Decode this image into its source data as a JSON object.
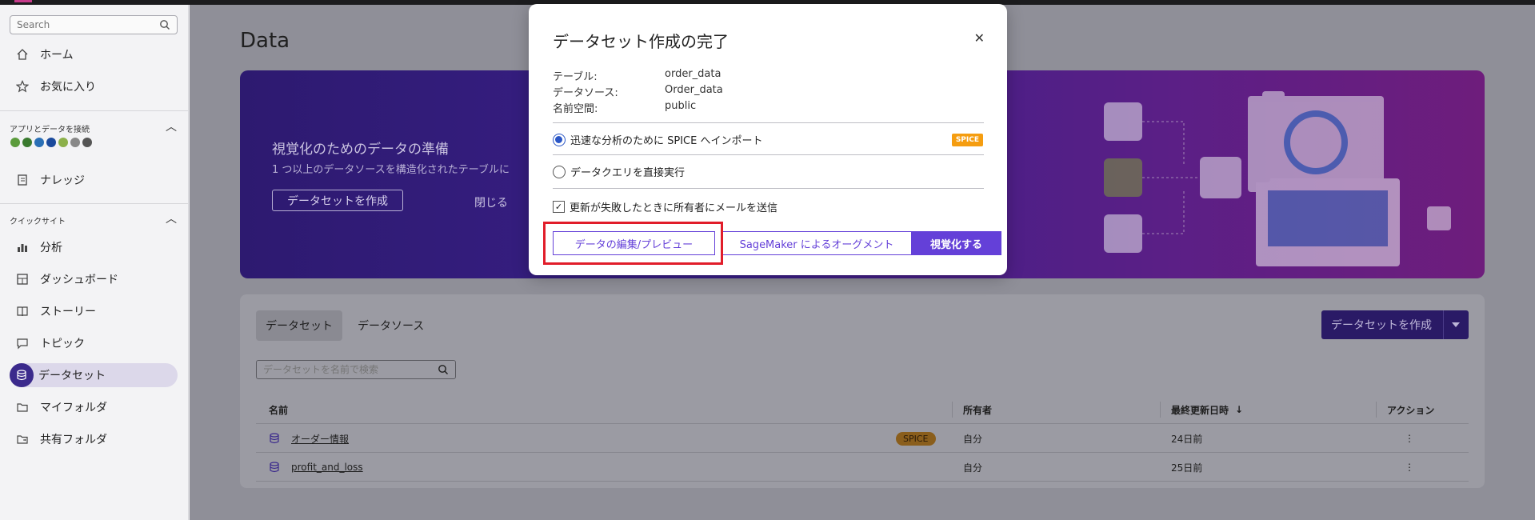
{
  "sidebar": {
    "search_placeholder": "Search",
    "items_top": [
      {
        "label": "ホーム",
        "icon": "home-icon"
      },
      {
        "label": "お気に入り",
        "icon": "star-icon"
      }
    ],
    "apps_section_title": "アプリとデータを接続",
    "knowledge": {
      "label": "ナレッジ",
      "icon": "knowledge-icon"
    },
    "quicksight_section_title": "クイックサイト",
    "items_bottom": [
      {
        "label": "分析",
        "icon": "analysis-icon"
      },
      {
        "label": "ダッシュボード",
        "icon": "dashboard-icon"
      },
      {
        "label": "ストーリー",
        "icon": "story-icon"
      },
      {
        "label": "トピック",
        "icon": "topic-icon"
      },
      {
        "label": "データセット",
        "icon": "dataset-icon"
      },
      {
        "label": "マイフォルダ",
        "icon": "folder-icon"
      },
      {
        "label": "共有フォルダ",
        "icon": "shared-folder-icon"
      }
    ]
  },
  "main": {
    "title": "Data",
    "hero": {
      "title": "視覚化のためのデータの準備",
      "subtitle": "1 つ以上のデータソースを構造化されたテーブルに",
      "create_button": "データセットを作成",
      "close": "閉じる"
    },
    "tabs": [
      {
        "label": "データセット"
      },
      {
        "label": "データソース"
      }
    ],
    "create_dataset_button": "データセットを作成",
    "search_placeholder": "データセットを名前で検索",
    "table": {
      "headers": [
        "名前",
        "所有者",
        "最終更新日時",
        "アクション"
      ],
      "rows": [
        {
          "name": "オーダー情報",
          "badge": "SPICE",
          "owner": "自分",
          "updated": "24日前"
        },
        {
          "name": "profit_and_loss",
          "badge": "",
          "owner": "自分",
          "updated": "25日前"
        }
      ]
    }
  },
  "modal": {
    "title": "データセット作成の完了",
    "details": [
      {
        "label": "テーブル:",
        "value": "order_data"
      },
      {
        "label": "データソース:",
        "value": "Order_data"
      },
      {
        "label": "名前空間:",
        "value": "public"
      }
    ],
    "option_spice": "迅速な分析のために SPICE へインポート",
    "spice_badge": "SPICE",
    "option_direct": "データクエリを直接実行",
    "email_checkbox": "更新が失敗したときに所有者にメールを送信",
    "buttons": {
      "edit_preview": "データの編集/プレビュー",
      "sagemaker": "SageMaker によるオーグメント",
      "visualize": "視覚化する"
    }
  },
  "colors": {
    "accent": "#6440d8",
    "highlight": "#e11d2a",
    "spice": "#f59d10"
  }
}
